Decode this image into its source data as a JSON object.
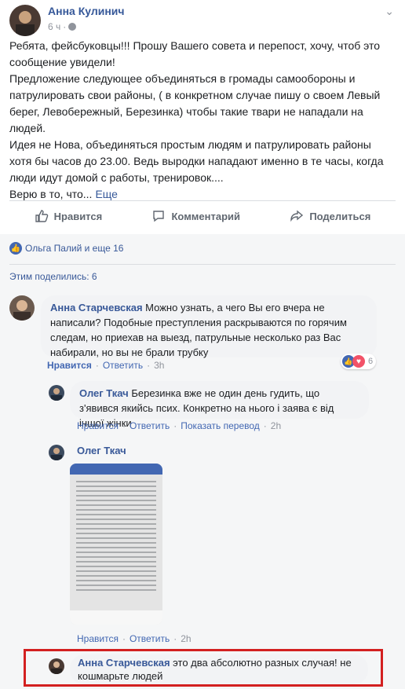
{
  "post": {
    "author": "Анна Кулинич",
    "time": "6 ч",
    "paragraphs": [
      "Ребята, фейсбуковцы!!! Прошу Вашего совета и перепост, хочу, чтоб это сообщение увидели!",
      "Предложение следующее объединяться в громады самообороны и патрулировать свои районы, ( в конкретном случае пишу о своем Левый берег, Левобережный, Березинка) чтобы такие твари не нападали на людей.",
      "Идея не Нова, объединяться простым людям и патрулировать районы хотя бы часов до 23.00. Ведь выродки нападают именно в те часы, когда люди идут домой с работы, тренировок....",
      "Верю в то, что..."
    ],
    "more_label": "Еще",
    "actions": {
      "like": "Нравится",
      "comment": "Комментарий",
      "share": "Поделиться"
    }
  },
  "reactions": {
    "summary": "Ольга Палий и еще 16",
    "shares": "Этим поделились: 6"
  },
  "comments": [
    {
      "author": "Анна Старчевская",
      "text": "Можно узнать, а чего Вы его вчера не написали? Подобные преступления раскрываются по горячим следам, но приехав на выезд, патрульные несколько раз Вас набирали, но вы не брали трубку",
      "like_label": "Нравится",
      "reply_label": "Ответить",
      "time": "3h",
      "reaction_count": "6"
    },
    {
      "author": "Олег Ткач",
      "text": "Березинка вже не один день гудить, що з'явився якийсь псих. Конкретно на нього і заява є від іншої жінки",
      "like_label": "Нравится",
      "reply_label": "Ответить",
      "translate_label": "Показать перевод",
      "time": "2h"
    },
    {
      "author": "Олег Ткач",
      "like_label": "Нравится",
      "reply_label": "Ответить",
      "time": "2h"
    },
    {
      "author": "Анна Старчевская",
      "text": "это два абсолютно разных случая! не кошмарьте людей"
    }
  ],
  "colors": {
    "link": "#365899",
    "muted": "#90949c",
    "highlight": "#d32020",
    "like": "#4267b2",
    "love": "#f25268"
  }
}
